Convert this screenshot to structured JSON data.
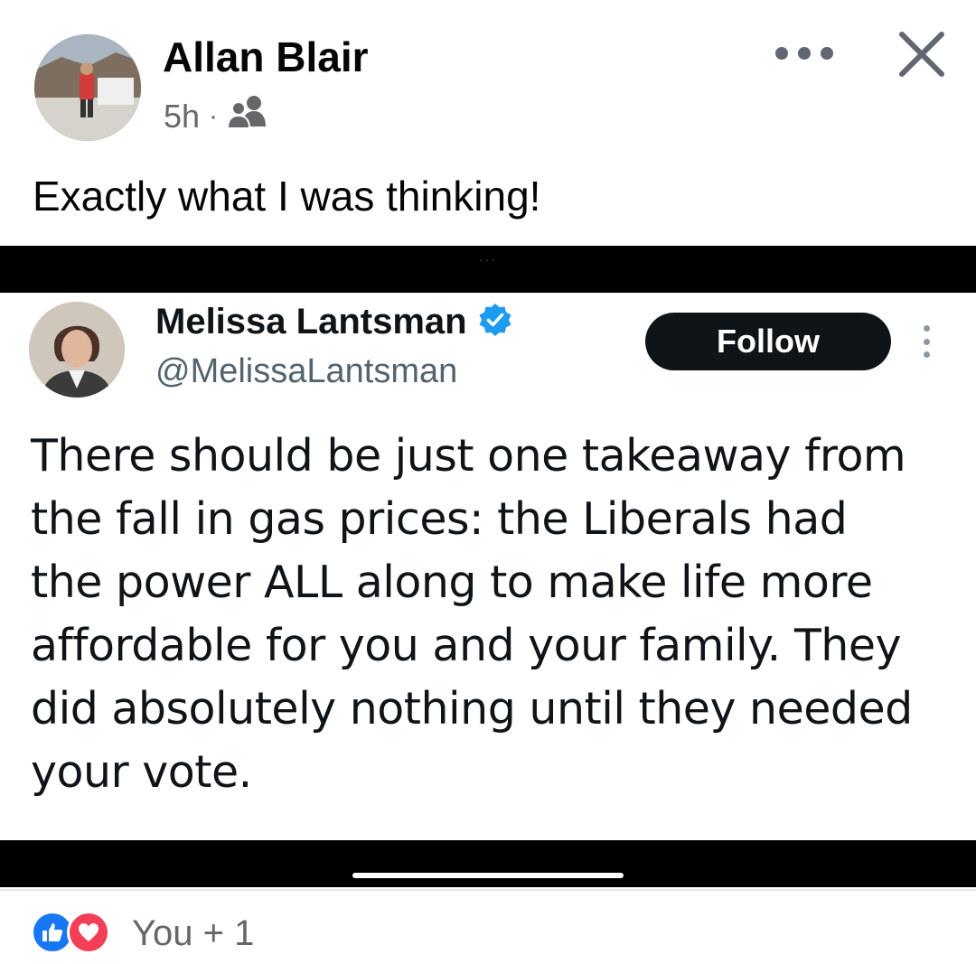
{
  "post": {
    "author": "Allan Blair",
    "time": "5h",
    "separator": "·",
    "audience_icon": "friends-icon",
    "text": "Exactly what I was thinking!"
  },
  "embedded_tweet": {
    "name": "Melissa Lantsman",
    "verified_icon": "verified-badge-icon",
    "handle": "@MelissaLantsman",
    "follow_label": "Follow",
    "text": "There should be just one takeaway from the fall in gas prices: the Liberals had the power ALL along to make life more affordable for you and your family. They did absolutely nothing until they needed your vote.",
    "text_lines": [
      "There should be just one takeaway from",
      "the fall in gas prices: the Liberals had",
      "the power ALL along to make life more",
      "affordable for you and your family. They",
      "did absolutely nothing until they needed",
      "your vote."
    ]
  },
  "reactions": {
    "icons": [
      "like-icon",
      "love-icon"
    ],
    "summary": "You + 1"
  },
  "colors": {
    "like_blue": "#1877f2",
    "love_red": "#f33e58",
    "verified_blue": "#1d9bf0",
    "secondary_text": "#65676b"
  }
}
